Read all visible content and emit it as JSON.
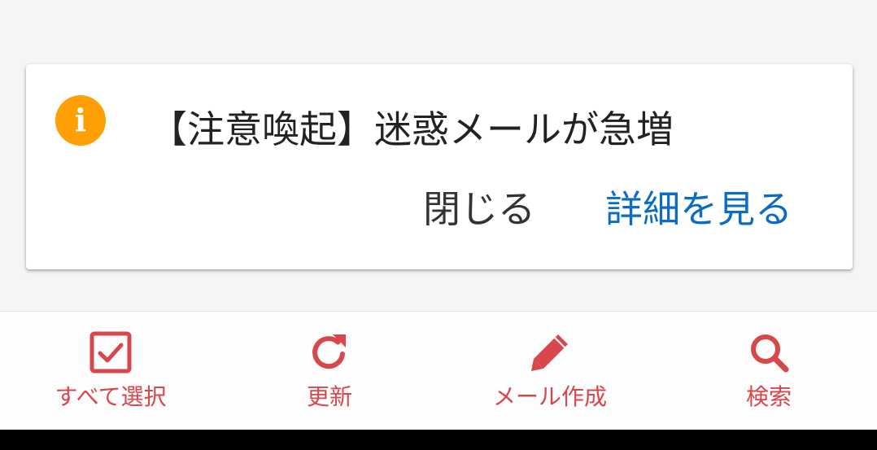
{
  "notice": {
    "title": "【注意喚起】迷惑メールが急増",
    "icon": "info-icon",
    "icon_glyph": "i",
    "icon_color": "#ff9f06",
    "dismiss_label": "閉じる",
    "details_label": "詳細を見る",
    "details_color": "#0b6cc4"
  },
  "toolbar": {
    "accent_color": "#d8474c",
    "items": [
      {
        "label": "すべて選択",
        "icon": "checkbox-checked-icon"
      },
      {
        "label": "更新",
        "icon": "refresh-icon"
      },
      {
        "label": "メール作成",
        "icon": "pencil-icon"
      },
      {
        "label": "検索",
        "icon": "search-icon"
      }
    ]
  }
}
